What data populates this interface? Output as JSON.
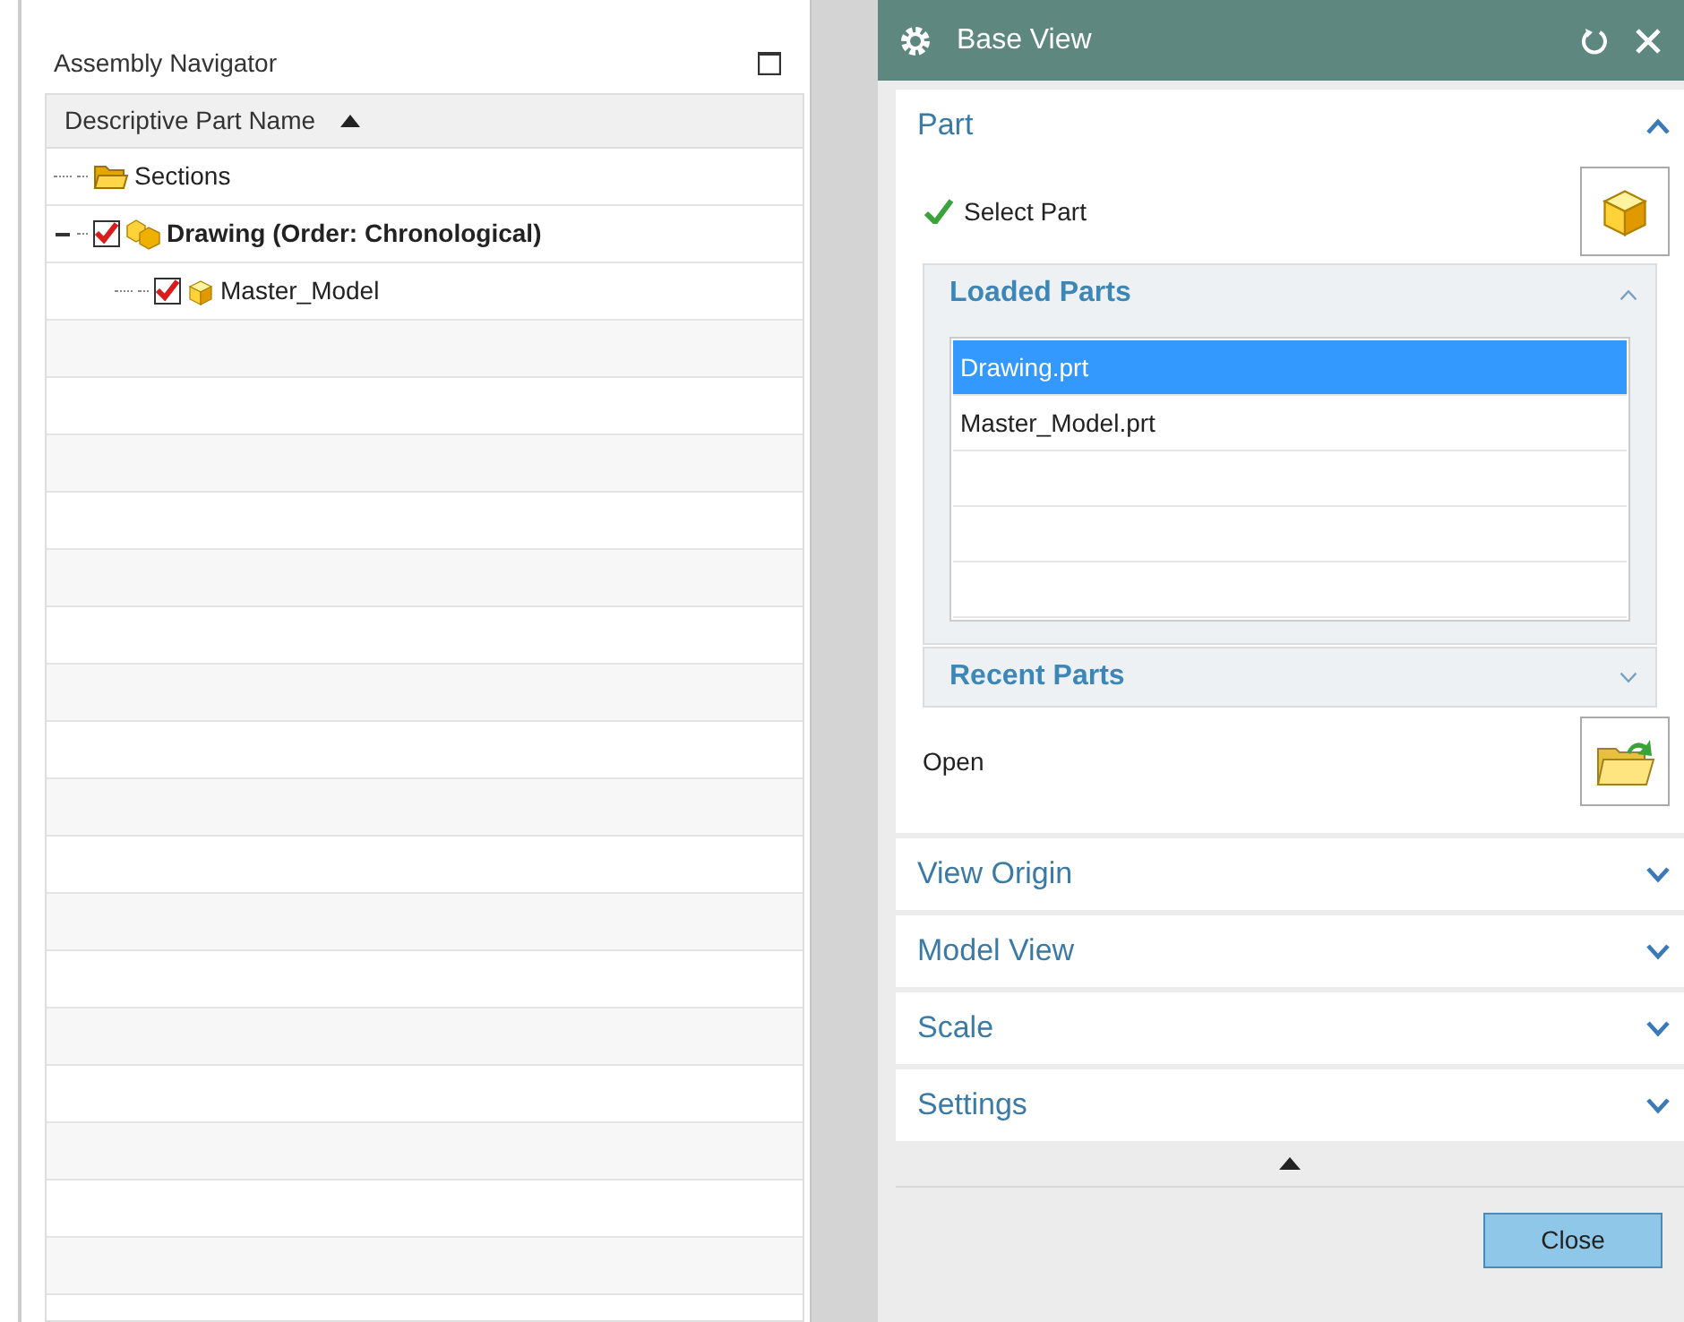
{
  "navigator": {
    "title": "Assembly Navigator",
    "column_header": "Descriptive Part Name",
    "tree": [
      {
        "label": "Sections",
        "kind": "folder",
        "bold": false
      },
      {
        "label": "Drawing (Order: Chronological)",
        "kind": "assembly",
        "bold": true,
        "checked": true,
        "expanded": true,
        "children": [
          {
            "label": "Master_Model",
            "kind": "part",
            "bold": false,
            "checked": true
          }
        ]
      }
    ]
  },
  "dialog": {
    "title": "Base View",
    "sections": [
      {
        "title": "Part",
        "expanded": true,
        "select_label": "Select Part",
        "groups": [
          {
            "title": "Loaded Parts",
            "expanded": true,
            "items": [
              {
                "label": "Drawing.prt",
                "selected": true
              },
              {
                "label": "Master_Model.prt",
                "selected": false
              }
            ]
          },
          {
            "title": "Recent Parts",
            "expanded": false
          }
        ],
        "open_label": "Open"
      },
      {
        "title": "View Origin",
        "expanded": false
      },
      {
        "title": "Model View",
        "expanded": false
      },
      {
        "title": "Scale",
        "expanded": false
      },
      {
        "title": "Settings",
        "expanded": false
      }
    ],
    "close_button": "Close"
  }
}
